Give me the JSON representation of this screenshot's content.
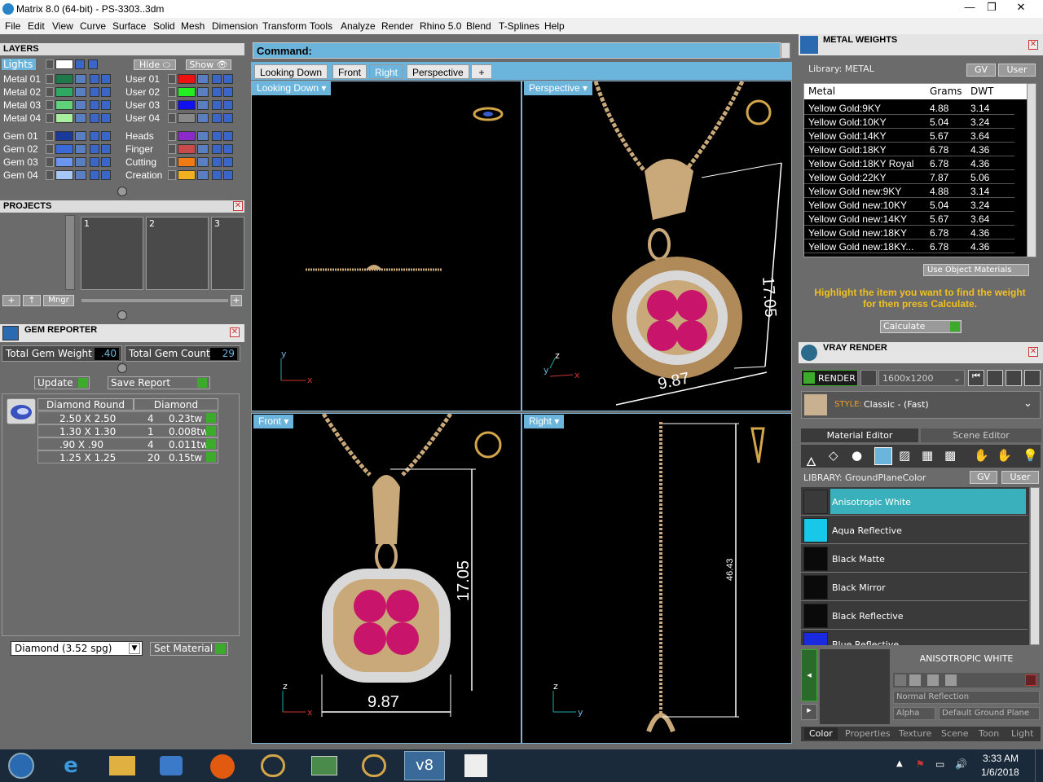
{
  "window": {
    "title": "Matrix 8.0 (64-bit) - PS-3303..3dm"
  },
  "menu": [
    "File",
    "Edit",
    "View",
    "Curve",
    "Surface",
    "Solid",
    "Mesh",
    "Dimension",
    "Transform",
    "Tools",
    "Analyze",
    "Render",
    "Rhino 5.0",
    "Blend",
    "T-Splines",
    "Help"
  ],
  "layers": {
    "title": "LAYERS",
    "lights": "Lights",
    "hide": "Hide",
    "show": "Show",
    "left": [
      {
        "name": "Metal 01",
        "color": "#1e7a4a"
      },
      {
        "name": "Metal 02",
        "color": "#2fa862"
      },
      {
        "name": "Metal 03",
        "color": "#5fd27a"
      },
      {
        "name": "Metal 04",
        "color": "#a8f0a0"
      },
      {
        "name": "Gem 01",
        "color": "#1a3a9a"
      },
      {
        "name": "Gem 02",
        "color": "#3a6ad8"
      },
      {
        "name": "Gem 03",
        "color": "#6a96f0"
      },
      {
        "name": "Gem 04",
        "color": "#a6c6f6"
      }
    ],
    "right": [
      {
        "name": "User 01",
        "color": "#ee1111"
      },
      {
        "name": "User 02",
        "color": "#22ee22"
      },
      {
        "name": "User 03",
        "color": "#1111ee"
      },
      {
        "name": "User 04",
        "color": "#888888"
      },
      {
        "name": "Heads",
        "color": "#8a2ac8"
      },
      {
        "name": "Finger",
        "color": "#c84a4a"
      },
      {
        "name": "Cutting",
        "color": "#f07a14"
      },
      {
        "name": "Creation",
        "color": "#f0b020"
      }
    ]
  },
  "projects": {
    "title": "PROJECTS",
    "slots": [
      "1",
      "2",
      "3"
    ],
    "mngr": "Mngr"
  },
  "gem_reporter": {
    "title": "GEM REPORTER",
    "total_weight_label": "Total Gem Weight",
    "total_weight": ".40",
    "total_count_label": "Total Gem Count",
    "total_count": "29",
    "update": "Update",
    "save_report": "Save Report",
    "col1": "Diamond Round",
    "col2": "Diamond",
    "rows": [
      {
        "size": "2.50 X 2.50",
        "count": "4",
        "tw": "0.23tw"
      },
      {
        "size": "1.30 X 1.30",
        "count": "1",
        "tw": "0.008tw"
      },
      {
        "size": ".90 X .90",
        "count": "4",
        "tw": "0.011tw"
      },
      {
        "size": "1.25 X 1.25",
        "count": "20",
        "tw": "0.15tw"
      }
    ],
    "material_select": "Diamond   (3.52 spg)",
    "set_material": "Set Material"
  },
  "command": {
    "label": "Command:"
  },
  "tabs": [
    "Looking Down",
    "Front",
    "Right",
    "Perspective",
    "+"
  ],
  "viewports": {
    "tl": "Looking Down",
    "tr": "Perspective",
    "bl": "Front",
    "br": "Right",
    "dim_width": "9.87",
    "dim_height": "17.05",
    "dim_chain": "46.43"
  },
  "metal_weights": {
    "title": "METAL WEIGHTS",
    "library": "Library: METAL",
    "gv": "GV",
    "user": "User",
    "cols": [
      "Metal",
      "Grams",
      "DWT"
    ],
    "rows": [
      {
        "metal": "Yellow Gold:9KY",
        "grams": "4.88",
        "dwt": "3.14"
      },
      {
        "metal": "Yellow Gold:10KY",
        "grams": "5.04",
        "dwt": "3.24"
      },
      {
        "metal": "Yellow Gold:14KY",
        "grams": "5.67",
        "dwt": "3.64"
      },
      {
        "metal": "Yellow Gold:18KY",
        "grams": "6.78",
        "dwt": "4.36"
      },
      {
        "metal": "Yellow Gold:18KY Royal",
        "grams": "6.78",
        "dwt": "4.36"
      },
      {
        "metal": "Yellow Gold:22KY",
        "grams": "7.87",
        "dwt": "5.06"
      },
      {
        "metal": "Yellow Gold new:9KY",
        "grams": "4.88",
        "dwt": "3.14"
      },
      {
        "metal": "Yellow Gold new:10KY",
        "grams": "5.04",
        "dwt": "3.24"
      },
      {
        "metal": "Yellow Gold new:14KY",
        "grams": "5.67",
        "dwt": "3.64"
      },
      {
        "metal": "Yellow Gold new:18KY",
        "grams": "6.78",
        "dwt": "4.36"
      },
      {
        "metal": "Yellow Gold new:18KY...",
        "grams": "6.78",
        "dwt": "4.36"
      }
    ],
    "use_object_materials": "Use Object Materials",
    "hint": "Highlight the item you want to find the weight for then press Calculate.",
    "calculate": "Calculate"
  },
  "vray": {
    "title": "VRAY RENDER",
    "render": "RENDER",
    "resolution": "1600x1200",
    "style_label": "STYLE:",
    "style_value": "Classic - (Fast)",
    "tab_material": "Material Editor",
    "tab_scene": "Scene Editor",
    "library": "LIBRARY: GroundPlaneColor",
    "gv": "GV",
    "user": "User",
    "materials": [
      {
        "name": "Anisotropic White",
        "color": "#3a3a3a"
      },
      {
        "name": "Aqua Reflective",
        "color": "#18c8e8"
      },
      {
        "name": "Black Matte",
        "color": "#0a0a0a"
      },
      {
        "name": "Black Mirror",
        "color": "#0a0a0a"
      },
      {
        "name": "Black Reflective",
        "color": "#0a0a0a"
      },
      {
        "name": "Blue Reflective",
        "color": "#1a2ae0"
      }
    ],
    "selected_name": "ANISOTROPIC WHITE",
    "reflection": "Normal Reflection",
    "alpha": "Alpha",
    "ground": "Default Ground Plane",
    "bottom_tabs": [
      "Color",
      "Properties",
      "Texture",
      "Scene",
      "Toon",
      "Light"
    ]
  },
  "taskbar": {
    "time": "3:33 AM",
    "date": "1/6/2018"
  }
}
